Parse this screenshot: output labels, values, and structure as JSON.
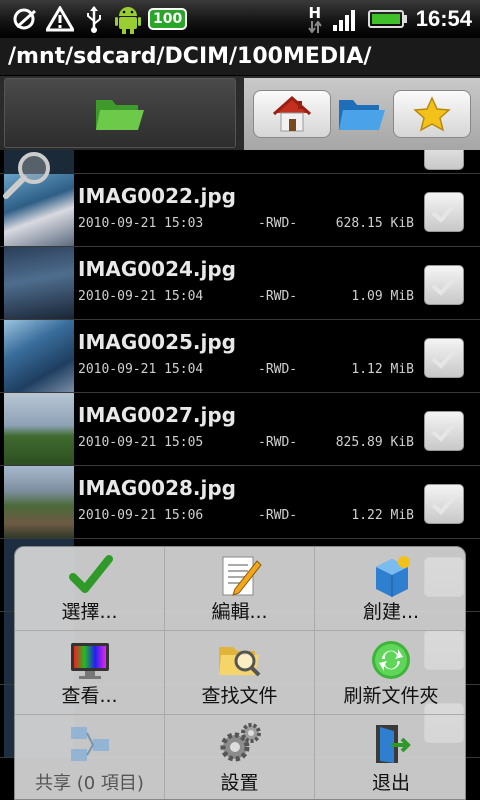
{
  "statusbar": {
    "battery_level_badge": "100",
    "network_label": "H",
    "time": "16:54"
  },
  "path": "/mnt/sdcard/DCIM/100MEDIA/",
  "files": [
    {
      "name": "IMAG0022.jpg",
      "date": "2010-09-21 15:03",
      "perm": "-RWD-",
      "size": "628.15 KiB"
    },
    {
      "name": "IMAG0024.jpg",
      "date": "2010-09-21 15:04",
      "perm": "-RWD-",
      "size": "1.09 MiB"
    },
    {
      "name": "IMAG0025.jpg",
      "date": "2010-09-21 15:04",
      "perm": "-RWD-",
      "size": "1.12 MiB"
    },
    {
      "name": "IMAG0027.jpg",
      "date": "2010-09-21 15:05",
      "perm": "-RWD-",
      "size": "825.89 KiB"
    },
    {
      "name": "IMAG0028.jpg",
      "date": "2010-09-21 15:06",
      "perm": "-RWD-",
      "size": "1.22 MiB"
    }
  ],
  "menu": {
    "select": "選擇...",
    "edit": "編輯...",
    "create": "創建...",
    "view": "查看...",
    "find": "查找文件",
    "refresh": "刷新文件夾",
    "share": "共享 (0 項目)",
    "settings": "設置",
    "exit": "退出"
  },
  "colors": {
    "folder_green": "#4aa832",
    "folder_blue": "#3b8fd6",
    "star_gold": "#f2c21b",
    "check_green": "#2f9a2a"
  }
}
